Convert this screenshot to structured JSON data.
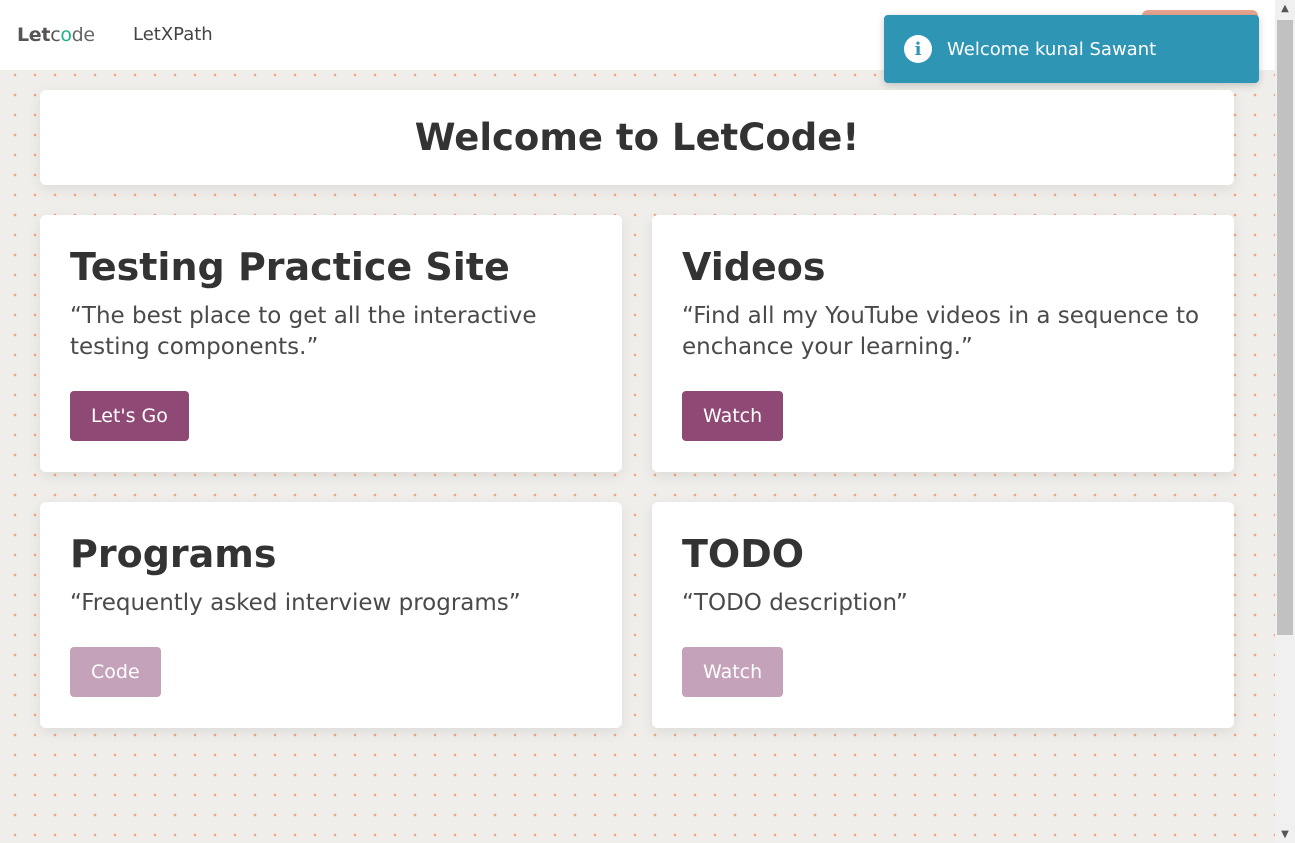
{
  "nav": {
    "logo": {
      "let": "Let",
      "c": "c",
      "o": "o",
      "de": "de"
    },
    "link": "LetXPath"
  },
  "toast": {
    "icon": "info-icon",
    "icon_glyph": "i",
    "message": "Welcome kunal Sawant"
  },
  "hero": {
    "title": "Welcome to LetCode!"
  },
  "cards": [
    {
      "title": "Testing Practice Site",
      "description": "“The best place to get all the interactive testing components.”",
      "button": "Let's Go"
    },
    {
      "title": "Videos",
      "description": "“Find all my YouTube videos in a sequence to enchance your learning.”",
      "button": "Watch"
    },
    {
      "title": "Programs",
      "description": "“Frequently asked interview programs”",
      "button": "Code"
    },
    {
      "title": "TODO",
      "description": "“TODO description”",
      "button": "Watch"
    }
  ],
  "colors": {
    "primary_button": "#8e4a75",
    "faded_button": "#c4a2b9",
    "toast_bg": "#2e95b4",
    "logo_accent": "#1bb38a"
  }
}
